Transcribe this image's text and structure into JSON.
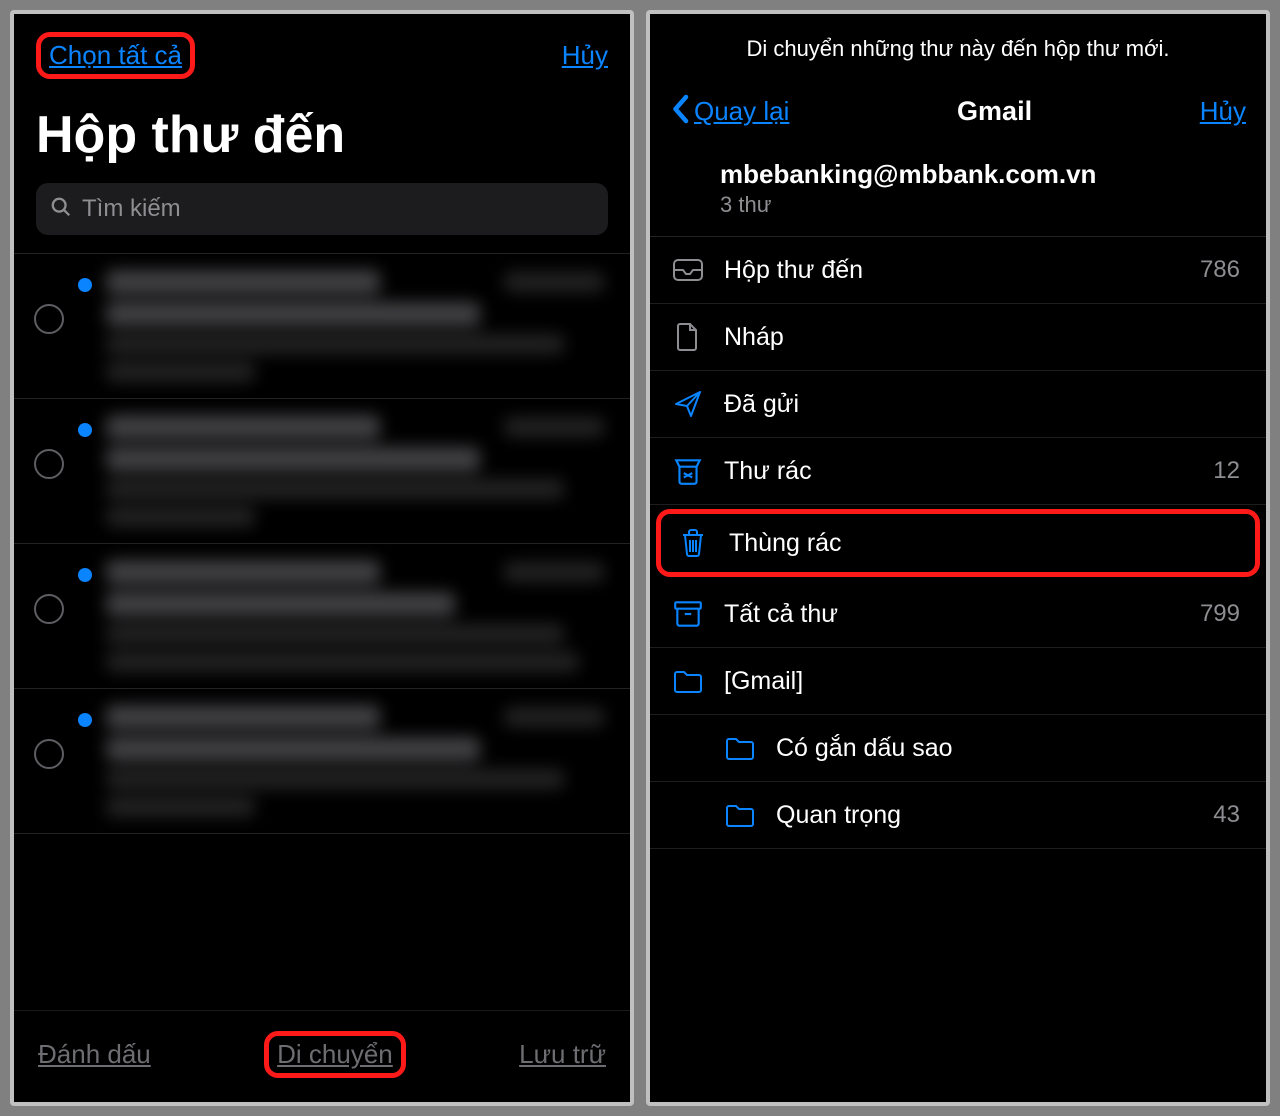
{
  "left": {
    "select_all": "Chọn tất cả",
    "cancel": "Hủy",
    "title": "Hộp thư đến",
    "search_placeholder": "Tìm kiếm",
    "toolbar": {
      "mark": "Đánh dấu",
      "move": "Di chuyển",
      "archive": "Lưu trữ"
    }
  },
  "right": {
    "instruction": "Di chuyển những thư này đến hộp thư mới.",
    "back": "Quay lại",
    "title": "Gmail",
    "cancel": "Hủy",
    "account": {
      "email": "mbebanking@mbbank.com.vn",
      "summary": "3 thư"
    },
    "folders": {
      "inbox": {
        "label": "Hộp thư đến",
        "count": "786"
      },
      "drafts": {
        "label": "Nháp",
        "count": ""
      },
      "sent": {
        "label": "Đã gửi",
        "count": ""
      },
      "junk": {
        "label": "Thư rác",
        "count": "12"
      },
      "trash": {
        "label": "Thùng rác",
        "count": ""
      },
      "allmail": {
        "label": "Tất cả thư",
        "count": "799"
      },
      "gmail": {
        "label": "[Gmail]",
        "count": ""
      },
      "starred": {
        "label": "Có gắn dấu sao",
        "count": ""
      },
      "important": {
        "label": "Quan trọng",
        "count": "43"
      }
    }
  }
}
